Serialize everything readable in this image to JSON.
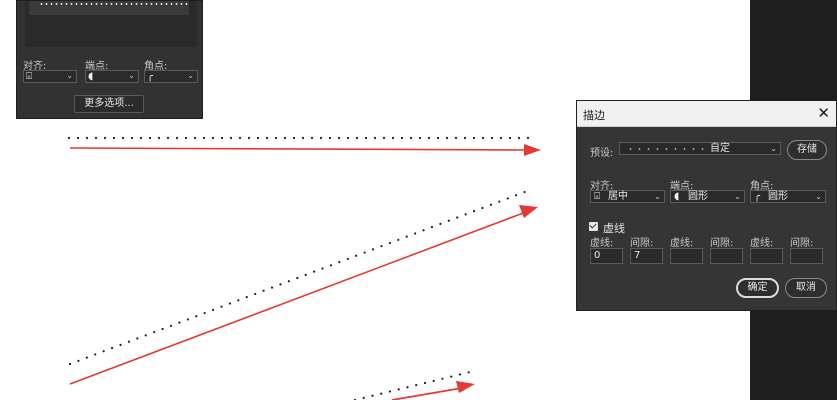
{
  "options_panel": {
    "align_label": "对齐:",
    "cap_label": "端点:",
    "corner_label": "角点:",
    "more_button": "更多选项..."
  },
  "dialog": {
    "title": "描边",
    "close": "✕",
    "preset_label": "预设:",
    "preset_value": "自定",
    "save_button": "存储",
    "align_label": "对齐:",
    "align_value": "居中",
    "cap_label": "端点:",
    "cap_value": "圆形",
    "corner_label": "角点:",
    "corner_value": "圆形",
    "dashed_label": "虚线",
    "dashed_checked": true,
    "fields": [
      {
        "label": "虚线:",
        "value": "0"
      },
      {
        "label": "间隙:",
        "value": "7"
      },
      {
        "label": "虚线:",
        "value": ""
      },
      {
        "label": "间隙:",
        "value": ""
      },
      {
        "label": "虚线:",
        "value": ""
      },
      {
        "label": "间隙:",
        "value": ""
      }
    ],
    "ok_button": "确定",
    "cancel_button": "取消"
  },
  "colors": {
    "arrow": "#e53935",
    "dots": "#1a1a1a",
    "dark_panel": "#1e1e1e"
  }
}
